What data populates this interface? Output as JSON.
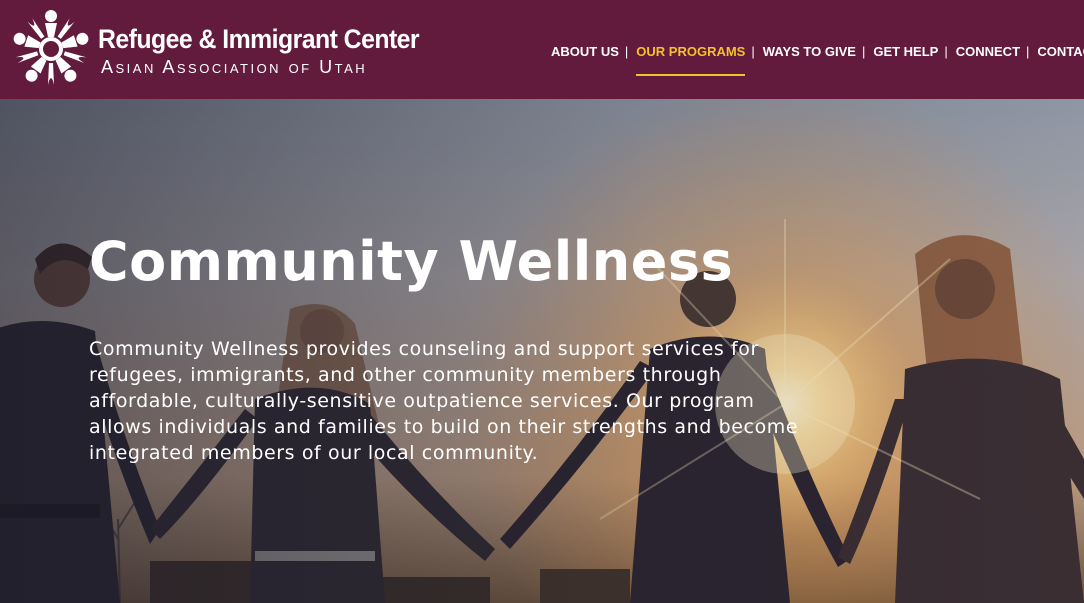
{
  "header": {
    "background_color": "#621b3c",
    "logo": {
      "title": "Refugee & Immigrant Center",
      "subtitle": "Asian Association of Utah",
      "icon": "people-circle-logo-icon"
    },
    "nav": {
      "items": [
        {
          "label": "ABOUT US",
          "active": false
        },
        {
          "label": "OUR PROGRAMS",
          "active": true
        },
        {
          "label": "WAYS TO GIVE",
          "active": false
        },
        {
          "label": "GET HELP",
          "active": false
        },
        {
          "label": "CONNECT",
          "active": false
        },
        {
          "label": "CONTACT",
          "active": false
        }
      ],
      "separator": "|",
      "active_color": "#f5c12d"
    }
  },
  "hero": {
    "title": "Community Wellness",
    "description": "Community Wellness provides counseling and support services for refugees, immigrants, and other community members through affordable, culturally-sensitive outpatience services. Our program allows individuals and families to build on their strengths and become integrated members of our local community.",
    "background_image": "people-holding-hands-at-sunset-photo"
  }
}
